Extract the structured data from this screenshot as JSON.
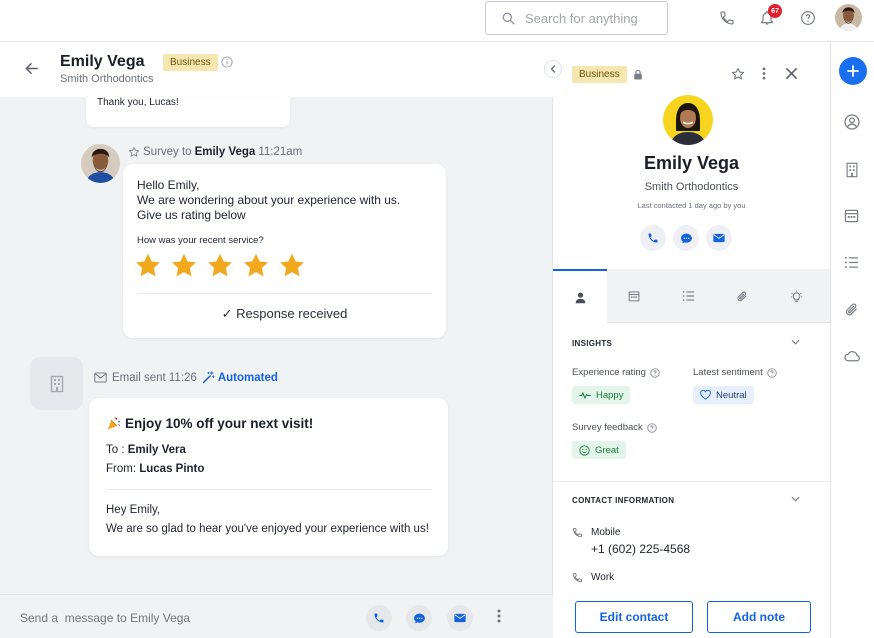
{
  "topbar": {
    "search_placeholder": "Search for anything",
    "notification_count": "67"
  },
  "conversation": {
    "contact_name": "Emily Vega",
    "company": "Smith Orthodontics",
    "tag": "Business",
    "previous_message": "Thank you, Lucas!",
    "survey": {
      "meta_label": "Survey to",
      "recipient": "Emily Vega",
      "time": "11:21am",
      "line1": "Hello Emily,",
      "line2": "We are wondering about your experience with us.",
      "line3": "Give us rating below",
      "question": "How was your recent service?",
      "rating": 5,
      "max_rating": 5,
      "response": "Response received"
    },
    "email": {
      "meta_label": "Email sent 11:26",
      "automated_label": "Automated",
      "subject": "Enjoy 10% off your next visit!",
      "to_label": "To :",
      "to_name": "Emily Vera",
      "from_label": "From:",
      "from_name": "Lucas Pinto",
      "greeting": "Hey Emily,",
      "body": "We are so glad to hear you've enjoyed your experience with us!"
    },
    "composer_placeholder": "Send a  message to Emily Vega"
  },
  "contact_panel": {
    "tag": "Business",
    "name": "Emily Vega",
    "company": "Smith Orthodontics",
    "last_contacted": "Last contacted 1 day ago by you",
    "insights": {
      "title": "INSIGHTS",
      "experience_label": "Experience rating",
      "experience_value": "Happy",
      "sentiment_label": "Latest sentiment",
      "sentiment_value": "Neutral",
      "feedback_label": "Survey feedback",
      "feedback_value": "Great"
    },
    "contact_info": {
      "title": "CONTACT INFORMATION",
      "mobile_label": "Mobile",
      "mobile_value": "+1 (602) 225-4568",
      "work_label": "Work"
    },
    "edit_button": "Edit contact",
    "note_button": "Add note"
  },
  "colors": {
    "accent": "#1363df",
    "star": "#f2a81d",
    "business_tag": "#f6e6b0"
  }
}
